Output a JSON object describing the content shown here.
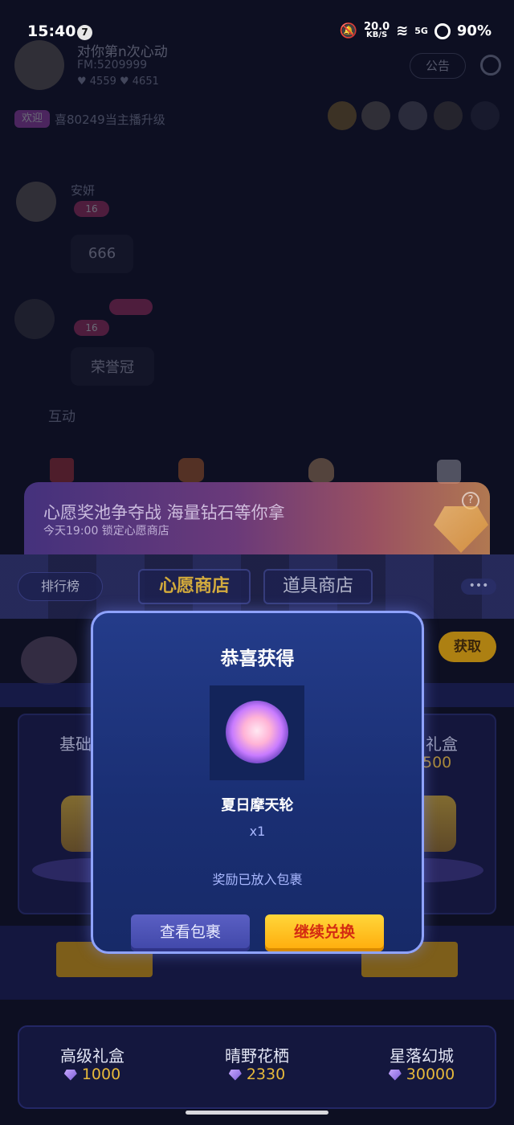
{
  "status_bar": {
    "time": "15:40",
    "notif_count": "7",
    "net_speed": "20.0",
    "net_unit": "KB/S",
    "signal": "5G",
    "battery": "90%"
  },
  "host": {
    "name": "对你第n次心动",
    "id": "FM:5209999",
    "stats": "♥ 4559   ♥ 4651",
    "announce_label": "公告"
  },
  "ticker": {
    "tag": "欢迎",
    "text": "喜80249当主播升级"
  },
  "chat": [
    {
      "user": "安妍",
      "level": "16",
      "message": "666"
    },
    {
      "user": "",
      "level": "16",
      "message": "荣誉冠"
    }
  ],
  "interaction_label": "互动",
  "banner": {
    "title": "心愿奖池争夺战 海量钻石等你拿",
    "subtitle": "今天19:00 锁定心愿商店",
    "help_icon": "?"
  },
  "shop": {
    "rank_label": "排行榜",
    "tabs": [
      {
        "label": "心愿商店",
        "active": true
      },
      {
        "label": "道具商店",
        "active": false
      }
    ],
    "more_label": "•••",
    "get_label": "获取",
    "partial_left_title": "基础",
    "partial_right_title": "礼盒",
    "partial_right_price": "500",
    "bottom_items": [
      {
        "name": "高级礼盒",
        "price": "1000"
      },
      {
        "name": "晴野花栖",
        "price": "2330"
      },
      {
        "name": "星落幻城",
        "price": "30000"
      }
    ]
  },
  "modal": {
    "title": "恭喜获得",
    "prize_name": "夏日摩天轮",
    "prize_qty": "x1",
    "note": "奖励已放入包裹",
    "view_label": "查看包裹",
    "continue_label": "继续兑换"
  },
  "colors": {
    "accent_yellow": "#ffab0a",
    "modal_border": "#8fa3ff",
    "continue_text": "#d42b12"
  }
}
